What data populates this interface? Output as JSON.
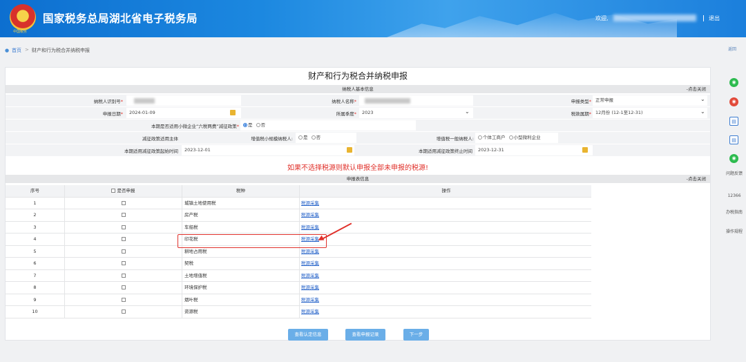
{
  "header": {
    "emblem_text": "中国税务",
    "site_title": "国家税务总局湖北省电子税务局",
    "welcome": "欢迎,",
    "logout": "退出"
  },
  "breadcrumb": {
    "home": "首页",
    "separator": ">",
    "current": "财产和行为税合并纳税申报",
    "return": "返回"
  },
  "rail": {
    "feedback": "问题反馈",
    "hotline": "12366",
    "guide": "办税指南",
    "rules": "操作规程"
  },
  "page": {
    "title": "财产和行为税合并纳税申报"
  },
  "basic": {
    "section_title": "纳税人基本信息",
    "toggle": "-点击关闭",
    "taxpayer_id_label": "纳税人识别号",
    "taxpayer_name_label": "纳税人名称",
    "declare_type_label": "申报类型",
    "declare_type_value": "正常申报",
    "declare_date_label": "申报日期",
    "declare_date_value": "2024-01-09",
    "belong_quarter_label": "所属季度",
    "belong_quarter_value": "2023",
    "tax_period_label": "税款属期",
    "tax_period_value": "12月份 (12-1至12-31)",
    "six_tax_label": "本期是否适用小微企业“六税两费”减征政策",
    "yes": "是",
    "no": "否",
    "relief_subject_label": "减征政策适用主体",
    "vat_small_label": "增值税小规模纳税人:",
    "vat_general_label": "增值税一般纳税人:",
    "individual": "个体工商户",
    "small_micro": "小型微利企业",
    "relief_start_label": "本期适用减征政策起始时间",
    "relief_start_value": "2023-12-01",
    "relief_end_label": "本期适用减征政策终止时间",
    "relief_end_value": "2023-12-31"
  },
  "warning": "如果不选择税源则默认申报全部未申报的税源!",
  "declare": {
    "section_title": "申报表信息",
    "toggle": "-点击关闭",
    "columns": [
      "序号",
      "是否申报",
      "税种",
      "操作"
    ],
    "rows": [
      {
        "no": "1",
        "tax": "城镇土地使用税",
        "op": "税源采集"
      },
      {
        "no": "2",
        "tax": "房产税",
        "op": "税源采集"
      },
      {
        "no": "3",
        "tax": "车船税",
        "op": "税源采集"
      },
      {
        "no": "4",
        "tax": "印花税",
        "op": "税源采集"
      },
      {
        "no": "5",
        "tax": "耕地占用税",
        "op": "税源采集"
      },
      {
        "no": "6",
        "tax": "契税",
        "op": "税源采集"
      },
      {
        "no": "7",
        "tax": "土地增值税",
        "op": "税源采集"
      },
      {
        "no": "8",
        "tax": "环境保护税",
        "op": "税源采集"
      },
      {
        "no": "9",
        "tax": "烟叶税",
        "op": "税源采集"
      },
      {
        "no": "10",
        "tax": "资源税",
        "op": "税源采集"
      }
    ]
  },
  "buttons": {
    "view_cert": "查看认定信息",
    "view_records": "查看申报记录",
    "next": "下一步"
  },
  "colors": {
    "header_blue": "#1c88e0",
    "warning_red": "#e0302a",
    "button_blue": "#6aaee8",
    "link_blue": "#2260c8"
  }
}
